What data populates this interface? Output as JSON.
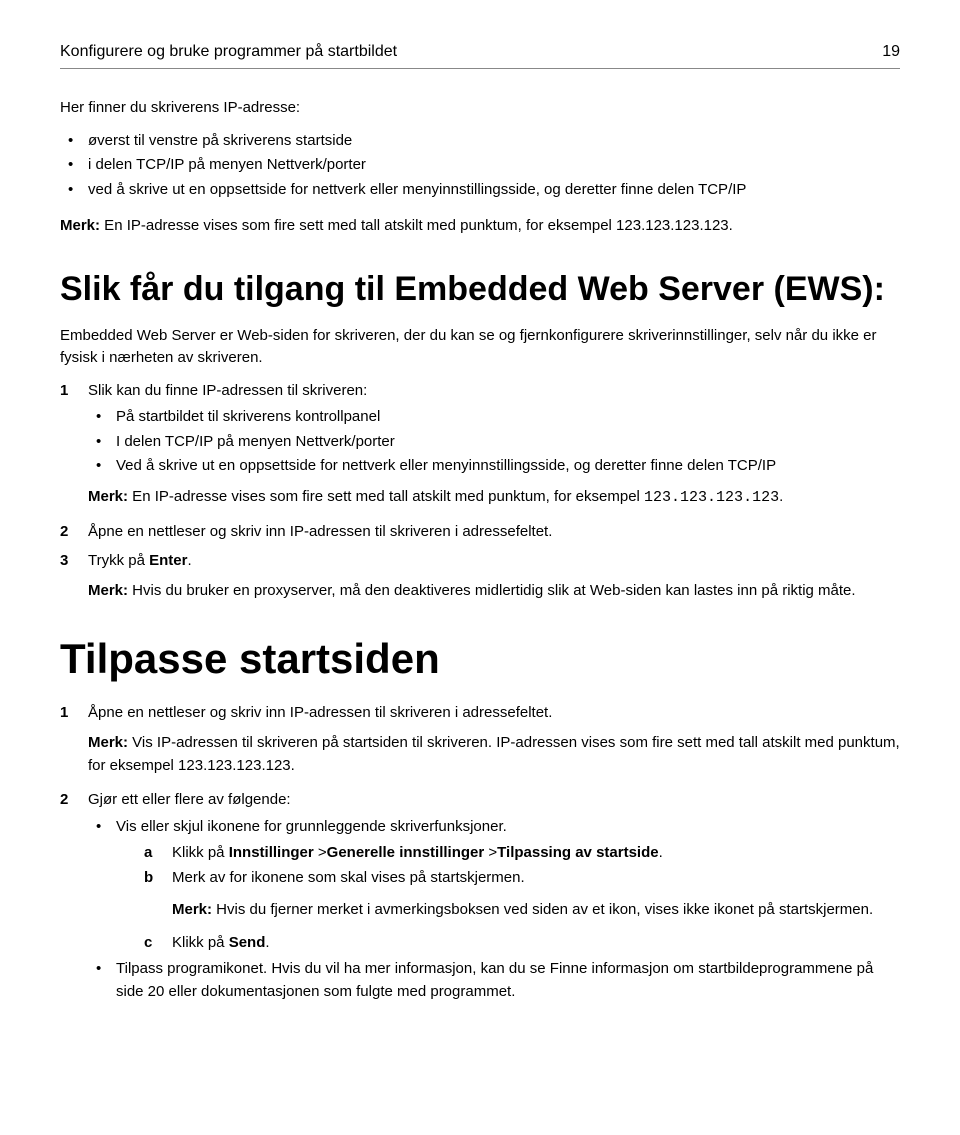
{
  "header": {
    "title": "Konfigurere og bruke programmer på startbildet",
    "page": "19"
  },
  "intro": {
    "line": "Her finner du skriverens IP-adresse:",
    "bullets": [
      "øverst til venstre på skriverens startside",
      "i delen TCP/IP på menyen Nettverk/porter",
      "ved å skrive ut en oppsettside for nettverk eller menyinnstillingsside, og deretter finne delen TCP/IP"
    ],
    "note_label": "Merk:",
    "note_text": " En IP-adresse vises som fire sett med tall atskilt med punktum, for eksempel 123.123.123.123."
  },
  "h1": "Slik får du tilgang til Embedded Web Server (EWS):",
  "ews_intro": "Embedded Web Server er Web-siden for skriveren, der du kan se og fjernkonfigurere skriverinnstillinger, selv når du ikke er fysisk i nærheten av skriveren.",
  "step1": {
    "num": "1",
    "text": "Slik kan du finne IP-adressen til skriveren:",
    "bullets": [
      "På startbildet til skriverens kontrollpanel",
      "I delen TCP/IP på menyen Nettverk/porter",
      "Ved å skrive ut en oppsettside for nettverk eller menyinnstillingsside, og deretter finne delen TCP/IP"
    ],
    "note_label": "Merk:",
    "note_text_pre": " En IP-adresse vises som fire sett med tall atskilt med punktum, for eksempel ",
    "note_code": "123.123.123.123",
    "note_text_post": "."
  },
  "step2": {
    "num": "2",
    "text": "Åpne en nettleser og skriv inn IP-adressen til skriveren i adressefeltet."
  },
  "step3": {
    "num": "3",
    "text_pre": "Trykk på ",
    "bold": "Enter",
    "text_post": ".",
    "note_label": "Merk:",
    "note_text": " Hvis du bruker en proxyserver, må den deaktiveres midlertidig slik at Web-siden kan lastes inn på riktig måte."
  },
  "h1b": "Tilpasse startsiden",
  "tstep1": {
    "num": "1",
    "text": "Åpne en nettleser og skriv inn IP-adressen til skriveren i adressefeltet.",
    "note_label": "Merk:",
    "note_text": " Vis IP-adressen til skriveren på startsiden til skriveren. IP-adressen vises som fire sett med tall atskilt med punktum, for eksempel 123.123.123.123."
  },
  "tstep2": {
    "num": "2",
    "text": "Gjør ett eller flere av følgende:",
    "bullet1": "Vis eller skjul ikonene for grunnleggende skriverfunksjoner.",
    "a": {
      "letter": "a",
      "pre": "Klikk på ",
      "b1": "Innstillinger",
      "sep1": " >",
      "b2": "Generelle innstillinger",
      "sep2": " >",
      "b3": "Tilpassing av startside",
      "post": "."
    },
    "b": {
      "letter": "b",
      "text": "Merk av for ikonene som skal vises på startskjermen."
    },
    "deep_note_label": "Merk:",
    "deep_note_text": " Hvis du fjerner merket i avmerkingsboksen ved siden av et ikon, vises ikke ikonet på startskjermen.",
    "c": {
      "letter": "c",
      "pre": "Klikk på ",
      "bold": "Send",
      "post": "."
    },
    "bullet2": "Tilpass programikonet. Hvis du vil ha mer informasjon, kan du se Finne informasjon om startbildeprogrammene på side 20 eller dokumentasjonen som fulgte med programmet."
  }
}
